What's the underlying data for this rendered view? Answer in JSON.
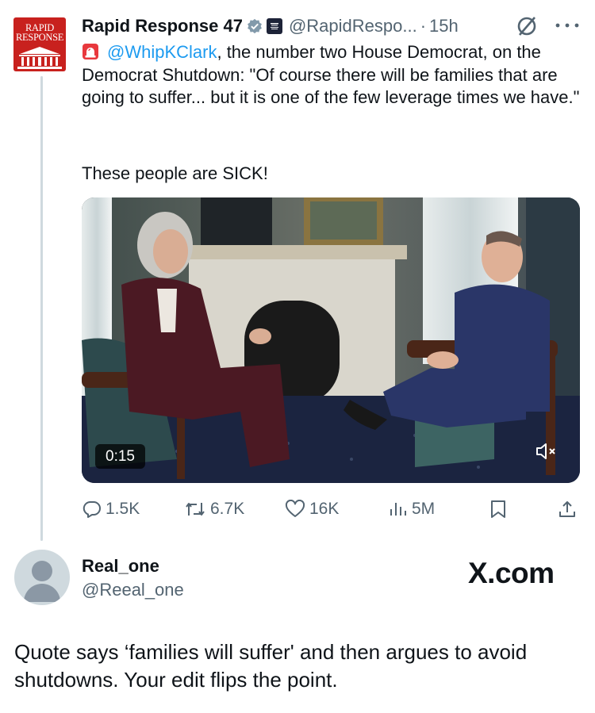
{
  "tweet": {
    "avatar_text_1": "RAPID",
    "avatar_text_2": "RESPONSE",
    "display_name": "Rapid Response 47",
    "handle": "@RapidRespo...",
    "separator": "·",
    "time": "15h",
    "mention": "@WhipKClark",
    "text_after_mention": ", the number two House Democrat, on the Democrat Shutdown: \"Of course there will be families that are going to suffer... but it is one of the few leverage times we have.\"",
    "text_line2": "These people are SICK!",
    "video": {
      "timestamp": "0:15",
      "muted": true
    },
    "stats": {
      "replies": "1.5K",
      "reposts": "6.7K",
      "likes": "16K",
      "views": "5M"
    }
  },
  "reply": {
    "display_name": "Real_one",
    "handle": "@Reeal_one",
    "watermark": "X.com",
    "text": "Quote says ‘families will suffer' and then argues to avoid shutdowns. Your edit flips the point."
  },
  "colors": {
    "accent": "#1d9bf0",
    "secondary_text": "#536471",
    "thread_line": "#cfd9de",
    "brand_red": "#c8211e"
  },
  "icons": [
    "verified-badge-icon",
    "white-house-badge-icon",
    "grok-icon",
    "more-icon",
    "siren-icon",
    "mute-icon",
    "reply-icon",
    "repost-icon",
    "like-icon",
    "views-icon",
    "bookmark-icon",
    "share-icon"
  ]
}
